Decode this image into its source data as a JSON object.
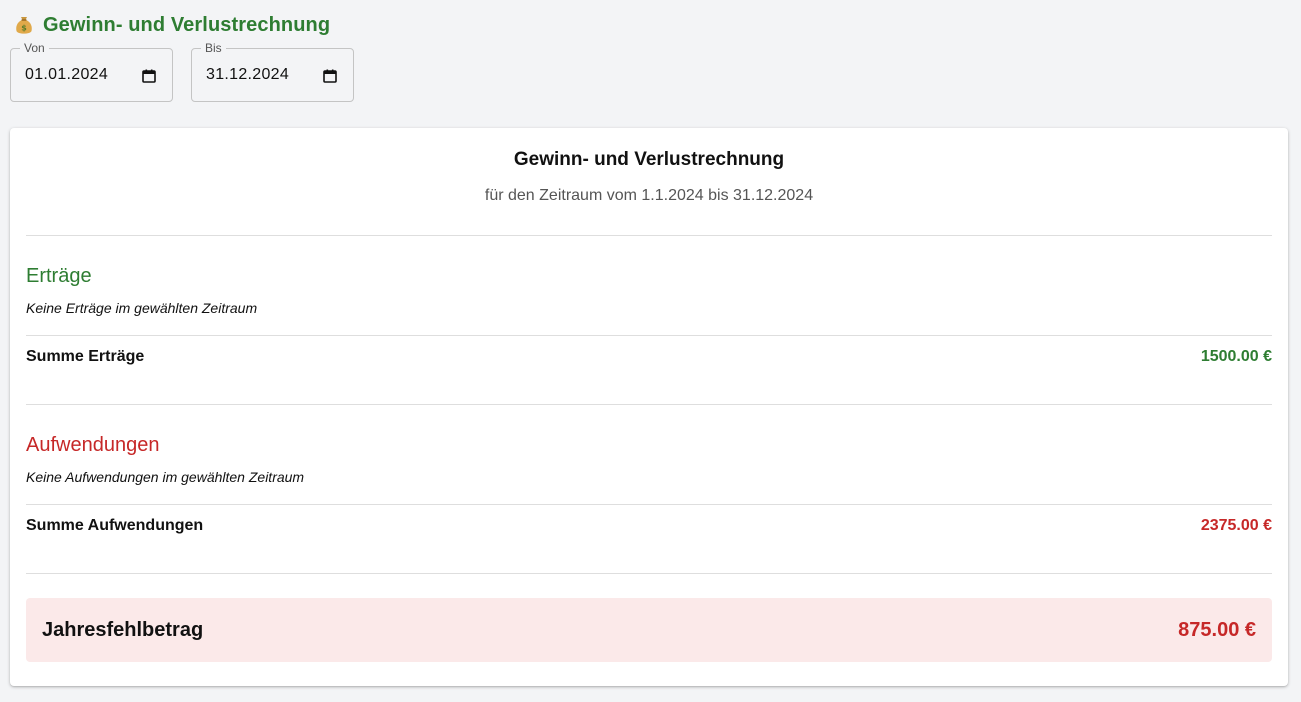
{
  "header": {
    "icon": "money-bag-icon",
    "title": "Gewinn- und Verlustrechnung"
  },
  "filters": {
    "from": {
      "label": "Von",
      "value": "01.01.2024"
    },
    "to": {
      "label": "Bis",
      "value": "31.12.2024"
    }
  },
  "report": {
    "title": "Gewinn- und Verlustrechnung",
    "subtitle": "für den Zeitraum vom 1.1.2024 bis 31.12.2024",
    "income": {
      "heading": "Erträge",
      "empty_note": "Keine Erträge im gewählten Zeitraum",
      "sum_label": "Summe Erträge",
      "sum_value": "1500.00 €"
    },
    "expenses": {
      "heading": "Aufwendungen",
      "empty_note": "Keine Aufwendungen im gewählten Zeitraum",
      "sum_label": "Summe Aufwendungen",
      "sum_value": "2375.00 €"
    },
    "result": {
      "label": "Jahresfehlbetrag",
      "value": "875.00 €"
    }
  },
  "colors": {
    "income": "#2e7d32",
    "expense": "#c62828",
    "result_background": "#fbe9e9"
  }
}
